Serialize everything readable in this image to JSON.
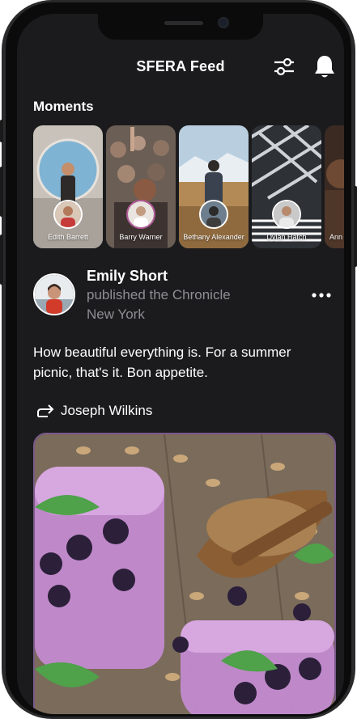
{
  "header": {
    "title": "SFERA Feed",
    "filter_icon": "sliders-icon",
    "notification_icon": "bell-icon"
  },
  "moments": {
    "label": "Moments",
    "items": [
      {
        "name": "Edith Barrett"
      },
      {
        "name": "Barry Warner"
      },
      {
        "name": "Bethany Alexander"
      },
      {
        "name": "Dylan Hatch"
      },
      {
        "name": "Ann"
      }
    ]
  },
  "post": {
    "author": "Emily Short",
    "action": "published the Chronicle",
    "location": "New York",
    "caption": "How beautiful everything is. For a summer picnic, that's it. Bon appetite.",
    "repost_icon": "repost-icon",
    "reposted_by": "Joseph Wilkins",
    "more_icon": "more-dots-icon"
  },
  "colors": {
    "background": "#1b1b1d",
    "text": "#ffffff",
    "muted": "#8e8e93",
    "photo_border": "#7a5a8a"
  }
}
